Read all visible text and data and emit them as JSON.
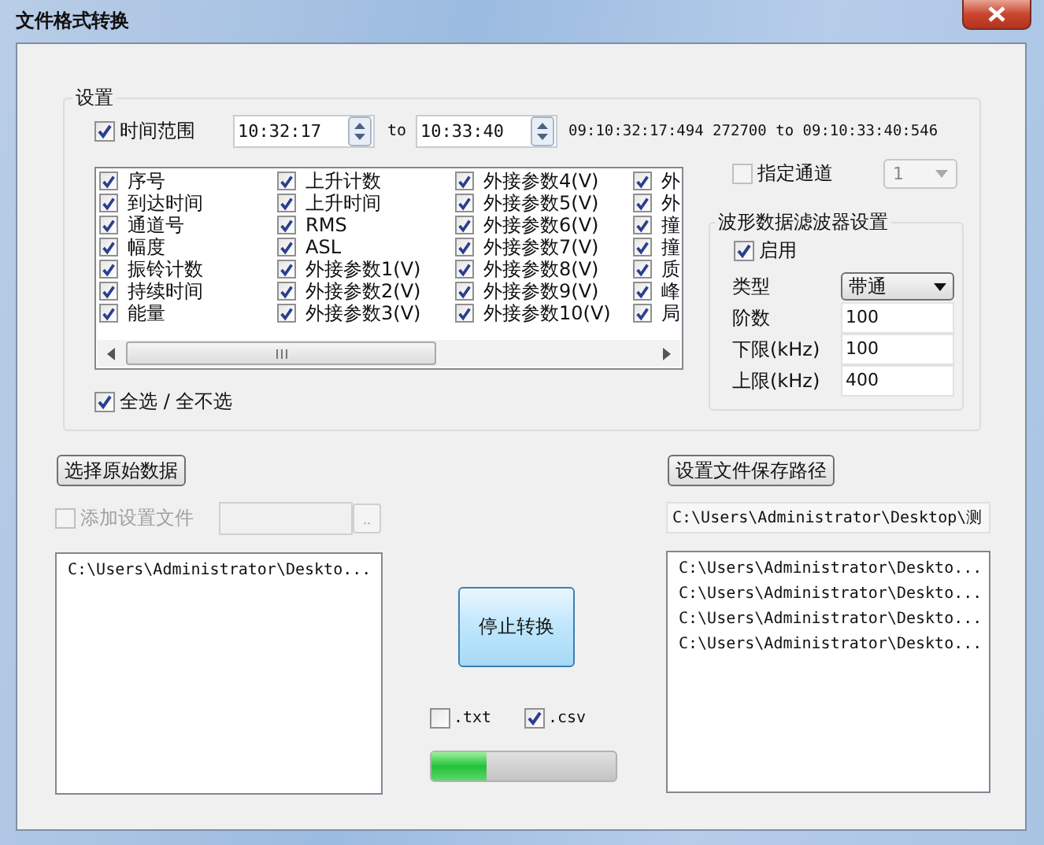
{
  "window": {
    "title": "文件格式转换"
  },
  "settings": {
    "title": "设置",
    "time_range": {
      "label": "时间范围",
      "checked": true,
      "start": "10:32:17",
      "separator": "to",
      "end": "10:33:40",
      "span": "09:10:32:17:494 272700 to 09:10:33:40:546"
    },
    "columns": [
      [
        {
          "label": "序号",
          "checked": true
        },
        {
          "label": "到达时间",
          "checked": true
        },
        {
          "label": "通道号",
          "checked": true
        },
        {
          "label": "幅度",
          "checked": true
        },
        {
          "label": "振铃计数",
          "checked": true
        },
        {
          "label": "持续时间",
          "checked": true
        },
        {
          "label": "能量",
          "checked": true
        }
      ],
      [
        {
          "label": "上升计数",
          "checked": true
        },
        {
          "label": "上升时间",
          "checked": true
        },
        {
          "label": "RMS",
          "checked": true
        },
        {
          "label": "ASL",
          "checked": true
        },
        {
          "label": "外接参数1(V)",
          "checked": true
        },
        {
          "label": "外接参数2(V)",
          "checked": true
        },
        {
          "label": "外接参数3(V)",
          "checked": true
        }
      ],
      [
        {
          "label": "外接参数4(V)",
          "checked": true
        },
        {
          "label": "外接参数5(V)",
          "checked": true
        },
        {
          "label": "外接参数6(V)",
          "checked": true
        },
        {
          "label": "外接参数7(V)",
          "checked": true
        },
        {
          "label": "外接参数8(V)",
          "checked": true
        },
        {
          "label": "外接参数9(V)",
          "checked": true
        },
        {
          "label": "外接参数10(V)",
          "checked": true
        }
      ],
      [
        {
          "label": "外",
          "checked": true
        },
        {
          "label": "外",
          "checked": true
        },
        {
          "label": "撞",
          "checked": true
        },
        {
          "label": "撞",
          "checked": true
        },
        {
          "label": "质",
          "checked": true
        },
        {
          "label": "峰",
          "checked": true
        },
        {
          "label": "局",
          "checked": true
        }
      ]
    ],
    "select_all": {
      "label": "全选 / 全不选",
      "checked": true
    },
    "channel": {
      "label": "指定通道",
      "checked": false,
      "value": "1"
    },
    "filter": {
      "title": "波形数据滤波器设置",
      "enable": {
        "label": "启用",
        "checked": true
      },
      "rows": [
        {
          "kind": "dropdown",
          "label": "类型",
          "value": "带通"
        },
        {
          "kind": "input",
          "label": "阶数",
          "value": "100"
        },
        {
          "kind": "input",
          "label": "下限(kHz)",
          "value": "100"
        },
        {
          "kind": "input",
          "label": "上限(kHz)",
          "value": "400"
        }
      ]
    }
  },
  "source": {
    "button": "选择原始数据",
    "settings_file": {
      "label": "添加设置文件",
      "checked": false,
      "disabled": true
    },
    "browse": "..",
    "files": [
      "C:\\Users\\Administrator\\Deskto..."
    ]
  },
  "convert": {
    "button": "停止转换",
    "formats": [
      {
        "label": ".txt",
        "checked": false
      },
      {
        "label": ".csv",
        "checked": true
      }
    ],
    "progress": {
      "level": 0.3
    }
  },
  "output": {
    "button": "设置文件保存路径",
    "path": "C:\\Users\\Administrator\\Desktop\\测",
    "files": [
      "C:\\Users\\Administrator\\Deskto...",
      "C:\\Users\\Administrator\\Deskto...",
      "C:\\Users\\Administrator\\Deskto...",
      "C:\\Users\\Administrator\\Deskto..."
    ]
  }
}
